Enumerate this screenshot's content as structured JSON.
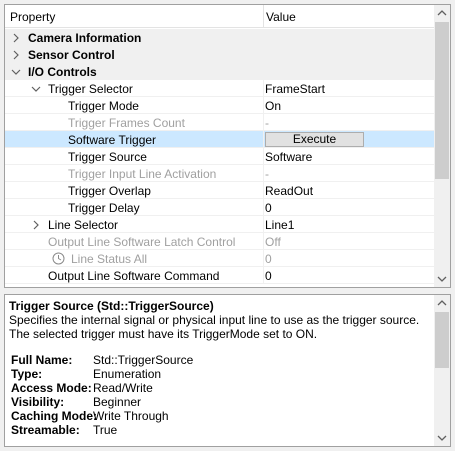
{
  "grid": {
    "header": {
      "property": "Property",
      "value": "Value"
    },
    "categories": {
      "camera_information": "Camera Information",
      "sensor_control": "Sensor Control",
      "io_controls": "I/O Controls"
    },
    "rows": {
      "trigger_selector": {
        "label": "Trigger Selector",
        "value": "FrameStart"
      },
      "trigger_mode": {
        "label": "Trigger Mode",
        "value": "On"
      },
      "trigger_frames_count": {
        "label": "Trigger Frames Count",
        "value": "-"
      },
      "software_trigger": {
        "label": "Software Trigger",
        "button": "Execute"
      },
      "trigger_source": {
        "label": "Trigger Source",
        "value": "Software"
      },
      "trigger_input_line_activation": {
        "label": "Trigger Input Line Activation",
        "value": "-"
      },
      "trigger_overlap": {
        "label": "Trigger Overlap",
        "value": "ReadOut"
      },
      "trigger_delay": {
        "label": "Trigger Delay",
        "value": "0"
      },
      "line_selector": {
        "label": "Line Selector",
        "value": "Line1"
      },
      "output_line_software_latch_control": {
        "label": "Output Line Software Latch Control",
        "value": "Off"
      },
      "line_status_all": {
        "label": "Line Status All",
        "value": "0"
      },
      "output_line_software_command": {
        "label": "Output Line Software Command",
        "value": "0"
      }
    }
  },
  "description": {
    "title": "Trigger Source (Std::TriggerSource)",
    "text": "Specifies the internal signal or physical input line to use as the trigger source. The selected trigger must have its TriggerMode set to ON.",
    "details": [
      {
        "key": "Full Name:",
        "value": "Std::TriggerSource"
      },
      {
        "key": "Type:",
        "value": "Enumeration"
      },
      {
        "key": "Access Mode:",
        "value": "Read/Write"
      },
      {
        "key": "Visibility:",
        "value": "Beginner"
      },
      {
        "key": "Caching Mode:",
        "value": "Write Through"
      },
      {
        "key": "Streamable:",
        "value": "True"
      }
    ]
  }
}
